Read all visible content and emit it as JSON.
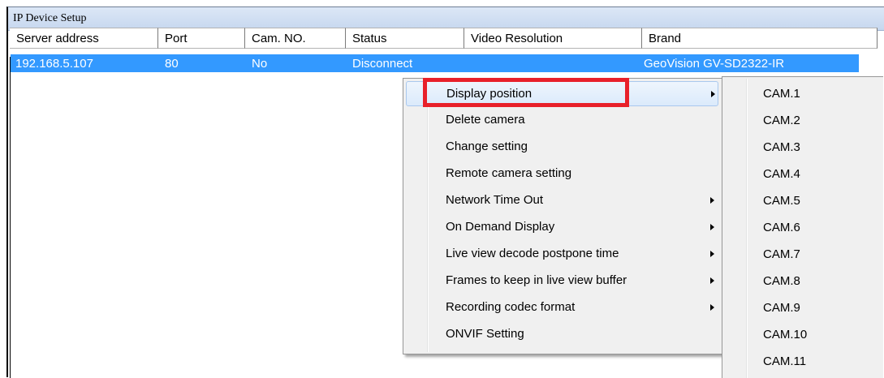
{
  "window": {
    "title": "IP Device Setup"
  },
  "columns": [
    "Server address",
    "Port",
    "Cam. NO.",
    "Status",
    "Video Resolution",
    "Brand"
  ],
  "rows": [
    {
      "server_address": "192.168.5.107",
      "port": "80",
      "cam_no": "No",
      "status": "Disconnect",
      "video_resolution": "",
      "brand": "GeoVision GV-SD2322-IR"
    }
  ],
  "context_menu": {
    "items": [
      {
        "label": "Display position",
        "submenu": true
      },
      {
        "label": "Delete camera",
        "submenu": false
      },
      {
        "label": "Change setting",
        "submenu": false
      },
      {
        "label": "Remote camera setting",
        "submenu": false
      },
      {
        "label": "Network Time Out",
        "submenu": true
      },
      {
        "label": "On Demand Display",
        "submenu": true
      },
      {
        "label": "Live view decode postpone time",
        "submenu": true
      },
      {
        "label": "Frames to keep in live view buffer",
        "submenu": true
      },
      {
        "label": "Recording codec format",
        "submenu": true
      },
      {
        "label": "ONVIF Setting",
        "submenu": false
      }
    ]
  },
  "submenu": {
    "items": [
      "CAM.1",
      "CAM.2",
      "CAM.3",
      "CAM.4",
      "CAM.5",
      "CAM.6",
      "CAM.7",
      "CAM.8",
      "CAM.9",
      "CAM.10",
      "CAM.11"
    ]
  },
  "colors": {
    "selection": "#3399ff",
    "highlight_box": "#e8202a",
    "menu_bg": "#f0f0f0"
  }
}
